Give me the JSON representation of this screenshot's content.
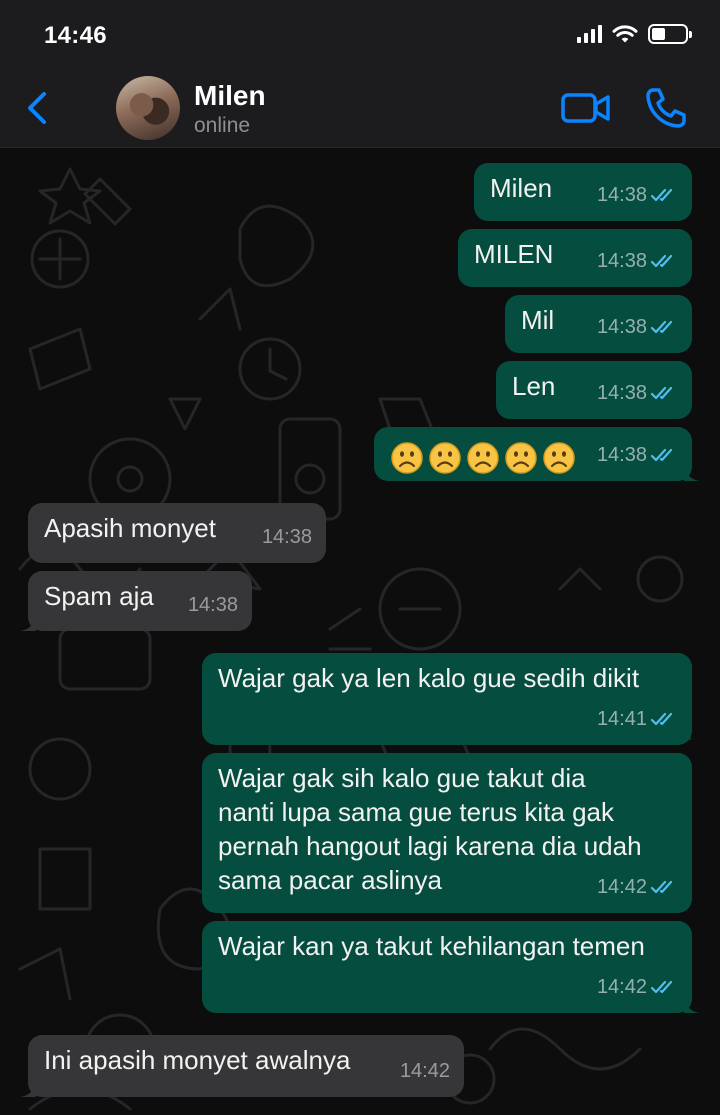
{
  "status_bar": {
    "time": "14:46"
  },
  "header": {
    "name": "Milen",
    "status": "online"
  },
  "colors": {
    "accent": "#0a84ff",
    "outgoing_bubble": "#054d3e",
    "incoming_bubble": "#363638",
    "read_tick": "#53bdeb"
  },
  "messages": [
    {
      "dir": "out",
      "text": "Milen",
      "time": "14:38",
      "read": true
    },
    {
      "dir": "out",
      "text": "MILEN",
      "time": "14:38",
      "read": true
    },
    {
      "dir": "out",
      "text": "Mil",
      "time": "14:38",
      "read": true
    },
    {
      "dir": "out",
      "text": "Len",
      "time": "14:38",
      "read": true
    },
    {
      "dir": "out",
      "emoji": [
        "frowning-face",
        "frowning-face",
        "frowning-face",
        "frowning-face",
        "frowning-face"
      ],
      "time": "14:38",
      "read": true
    },
    {
      "dir": "in",
      "text": "Apasih monyet",
      "time": "14:38"
    },
    {
      "dir": "in",
      "text": "Spam aja",
      "time": "14:38"
    },
    {
      "dir": "out",
      "text": "Wajar gak ya len kalo gue sedih dikit",
      "time": "14:41",
      "read": true
    },
    {
      "dir": "out",
      "text": "Wajar gak sih kalo gue takut dia\nnanti lupa sama gue terus kita gak\npernah hangout lagi karena dia udah\nsama pacar aslinya",
      "time": "14:42",
      "read": true
    },
    {
      "dir": "out",
      "text": "Wajar kan ya takut kehilangan temen",
      "time": "14:42",
      "read": true
    },
    {
      "dir": "in",
      "text": "Ini apasih monyet awalnya",
      "time": "14:42"
    }
  ]
}
